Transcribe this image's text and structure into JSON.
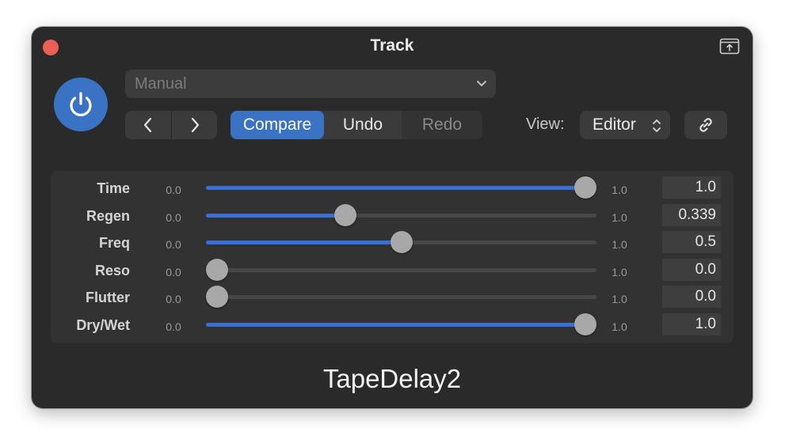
{
  "window": {
    "title": "Track",
    "plugin_name": "TapeDelay2"
  },
  "preset": {
    "value": "Manual"
  },
  "toolbar": {
    "compare_label": "Compare",
    "undo_label": "Undo",
    "redo_label": "Redo",
    "view_label": "View:",
    "view_value": "Editor"
  },
  "icons": {
    "close": "close-icon",
    "popout": "popout-icon",
    "power": "power-icon",
    "prev": "chevron-left-icon",
    "next": "chevron-right-icon",
    "dropdown": "chevron-down-icon",
    "updown": "updown-icon",
    "link": "link-icon"
  },
  "colors": {
    "accent": "#3a72c4",
    "slider_fill": "#3a6fd8",
    "close": "#ec5f55",
    "window_bg": "#2a2a2a"
  },
  "params": [
    {
      "name": "Time",
      "min": "0.0",
      "max": "1.0",
      "value": "1.0",
      "level": 1.0
    },
    {
      "name": "Regen",
      "min": "0.0",
      "max": "1.0",
      "value": "0.339",
      "level": 0.348
    },
    {
      "name": "Freq",
      "min": "0.0",
      "max": "1.0",
      "value": "0.5",
      "level": 0.5
    },
    {
      "name": "Reso",
      "min": "0.0",
      "max": "1.0",
      "value": "0.0",
      "level": 0.0
    },
    {
      "name": "Flutter",
      "min": "0.0",
      "max": "1.0",
      "value": "0.0",
      "level": 0.0
    },
    {
      "name": "Dry/Wet",
      "min": "0.0",
      "max": "1.0",
      "value": "1.0",
      "level": 1.0
    }
  ]
}
